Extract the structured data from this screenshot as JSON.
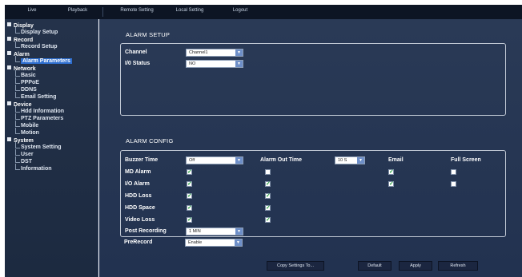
{
  "top_tabs": [
    "Live",
    "Playback",
    "Remote Setting",
    "Local Setting",
    "Logout"
  ],
  "sidebar": {
    "display": {
      "label": "Display",
      "items": [
        "Display Setup"
      ]
    },
    "record": {
      "label": "Record",
      "items": [
        "Record Setup"
      ]
    },
    "alarm": {
      "label": "Alarm",
      "items": [
        "Alarm Parameters"
      ]
    },
    "network": {
      "label": "Network",
      "items": [
        "Basic",
        "PPPoE",
        "DDNS",
        "Email Setting"
      ]
    },
    "device": {
      "label": "Device",
      "items": [
        "Hdd Information",
        "PTZ Parameters",
        "Mobile",
        "Motion"
      ]
    },
    "system": {
      "label": "System",
      "items": [
        "System Setting",
        "User",
        "DST",
        "Information"
      ]
    },
    "selected": "Alarm Parameters"
  },
  "alarm_setup": {
    "title": "ALARM SETUP",
    "channel_label": "Channel",
    "channel_value": "Channel1",
    "io_status_label": "I/0 Status",
    "io_status_value": "NO"
  },
  "alarm_config": {
    "title": "ALARM CONFIG",
    "buzzer_time_label": "Buzzer Time",
    "buzzer_time_value": "Off",
    "alarm_out_time_label": "Alarm Out Time",
    "alarm_out_time_value": "10 S",
    "email_header": "Email",
    "full_screen_header": "Full Screen",
    "rows": {
      "md_alarm": {
        "label": "MD Alarm",
        "col1": true,
        "col2": false,
        "email": true,
        "full_screen": false
      },
      "io_alarm": {
        "label": "I/O Alarm",
        "col1": true,
        "col2": true,
        "email": true,
        "full_screen": false
      },
      "hdd_loss": {
        "label": "HDD Loss",
        "col1": true,
        "col2": true
      },
      "hdd_space": {
        "label": "HDD Space",
        "col1": true,
        "col2": true
      },
      "video_loss": {
        "label": "Video Loss",
        "col1": true,
        "col2": true
      }
    },
    "post_recording_label": "Post Recording",
    "post_recording_value": "1 MIN",
    "prerecord_label": "PreRecord",
    "prerecord_value": "Enable"
  },
  "buttons": {
    "copy_settings": "Copy Settings To...",
    "default": "Default",
    "apply": "Apply",
    "refresh": "Refresh"
  }
}
